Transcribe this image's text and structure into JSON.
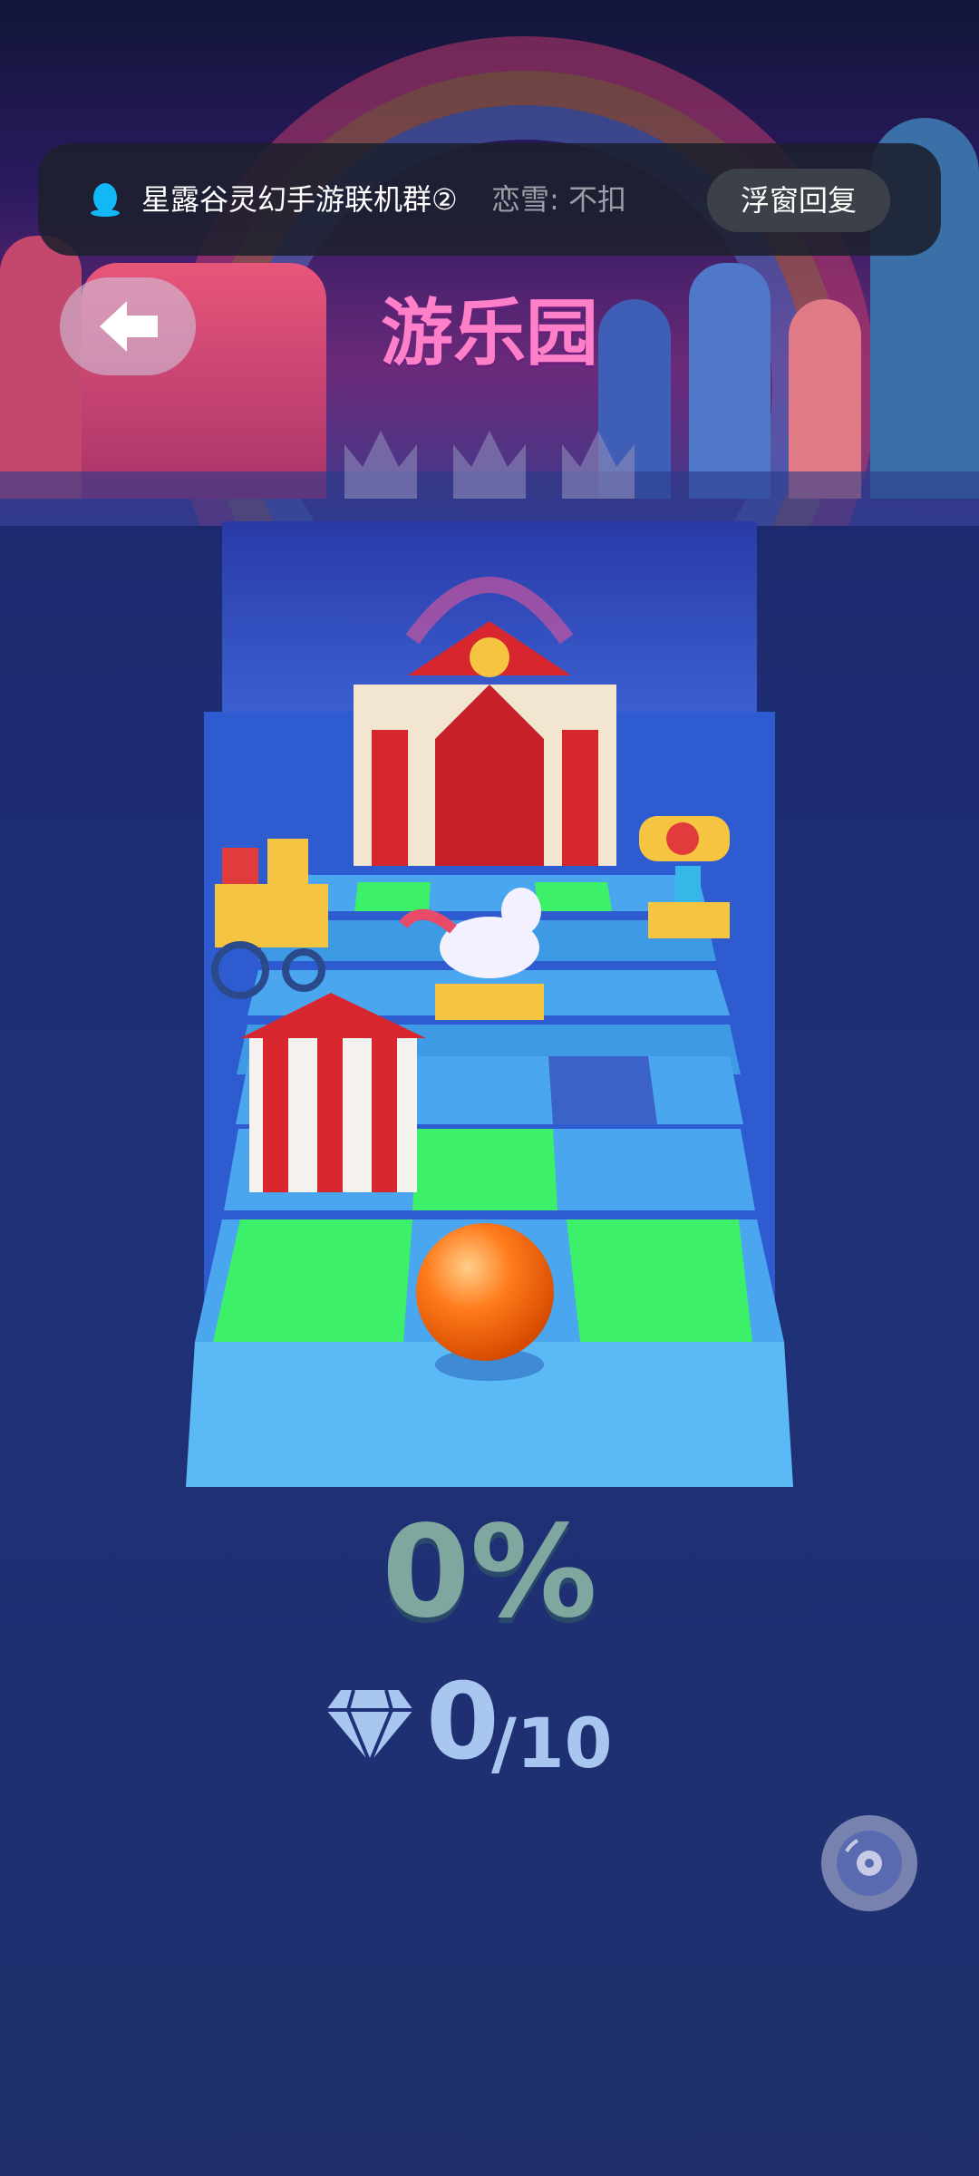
{
  "notification": {
    "app_icon": "qq-penguin-icon",
    "title": "星露谷灵幻手游联机群②",
    "message": "恋雪: 不扣",
    "reply_button": "浮窗回复"
  },
  "header": {
    "back_icon": "arrow-left-icon",
    "level_title": "游乐园",
    "crowns_earned": 0,
    "crowns_total": 3
  },
  "game": {
    "progress": "0%",
    "gems_collected": "0",
    "gems_total": "/10"
  },
  "controls": {
    "music_icon": "music-disc-icon"
  },
  "colors": {
    "title_pink": "#ff7fc8",
    "tile_blue": "#4aa6ee",
    "tile_green": "#3cf06a",
    "ball_orange": "#ff7a1a",
    "progress_text": "#7fa7a0",
    "gem_text": "#a9c6f0"
  }
}
